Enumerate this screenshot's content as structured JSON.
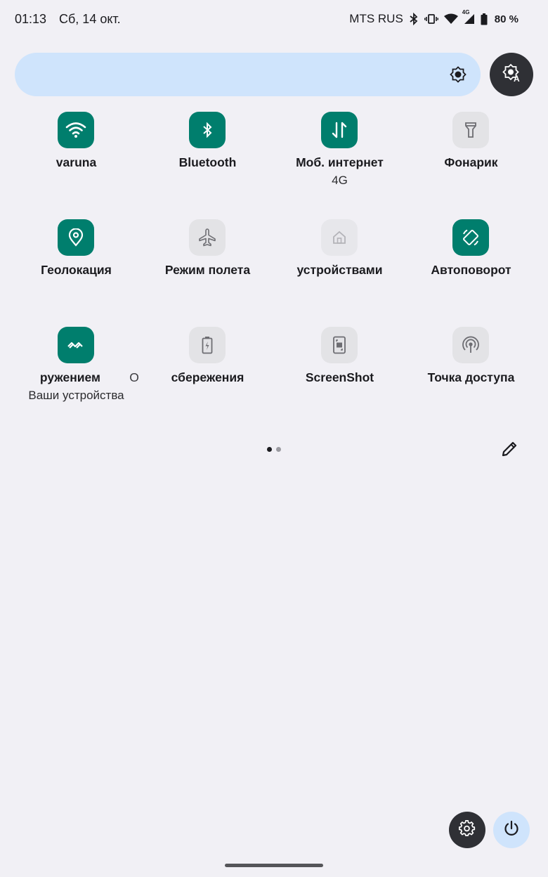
{
  "status_bar": {
    "time": "01:13",
    "date": "Сб, 14 окт.",
    "carrier": "MTS RUS",
    "network_type_badge": "4G",
    "battery_text": "80 %",
    "icons": [
      "bluetooth-icon",
      "vibrate-icon",
      "wifi-icon",
      "cell-signal-icon",
      "battery-icon"
    ]
  },
  "brightness": {
    "icon": "brightness-icon",
    "auto_icon": "auto-brightness-icon"
  },
  "tiles": [
    {
      "label": "varuna",
      "subtitle": "",
      "state": "on",
      "icon": "wifi-icon"
    },
    {
      "label": "Bluetooth",
      "subtitle": "",
      "state": "on",
      "icon": "bluetooth-icon"
    },
    {
      "label": "Моб. интернет",
      "subtitle": "4G",
      "state": "on",
      "icon": "mobile-data-icon"
    },
    {
      "label": "Фонарик",
      "subtitle": "",
      "state": "off",
      "icon": "flashlight-icon"
    },
    {
      "label": "Геолокация",
      "subtitle": "",
      "state": "on",
      "icon": "location-icon"
    },
    {
      "label": "Режим полета",
      "subtitle": "",
      "state": "off",
      "icon": "airplane-icon"
    },
    {
      "label": "устройствами",
      "subtitle": "",
      "state": "unavailable",
      "icon": "home-icon"
    },
    {
      "label": "Автоповорот",
      "subtitle": "",
      "state": "on",
      "icon": "auto-rotate-icon"
    },
    {
      "label": "ружением",
      "label_tail": "О",
      "subtitle": "Ваши устройства",
      "state": "on",
      "icon": "nearby-share-icon"
    },
    {
      "label": "сбережения",
      "subtitle": "",
      "state": "off",
      "icon": "battery-saver-icon"
    },
    {
      "label": "ScreenShot",
      "subtitle": "",
      "state": "off",
      "icon": "screenshot-icon"
    },
    {
      "label": "Точка доступа",
      "subtitle": "",
      "state": "off",
      "icon": "hotspot-icon"
    }
  ],
  "pager": {
    "pages": 2,
    "current": 1
  },
  "footer": {
    "edit_icon": "pencil-icon",
    "settings_icon": "gear-icon",
    "power_icon": "power-icon"
  },
  "colors": {
    "background": "#f1f0f5",
    "tile_active": "#007e6d",
    "tile_inactive": "#e3e3e6",
    "slider": "#cfe4fc",
    "dark_button": "#2f3035"
  }
}
